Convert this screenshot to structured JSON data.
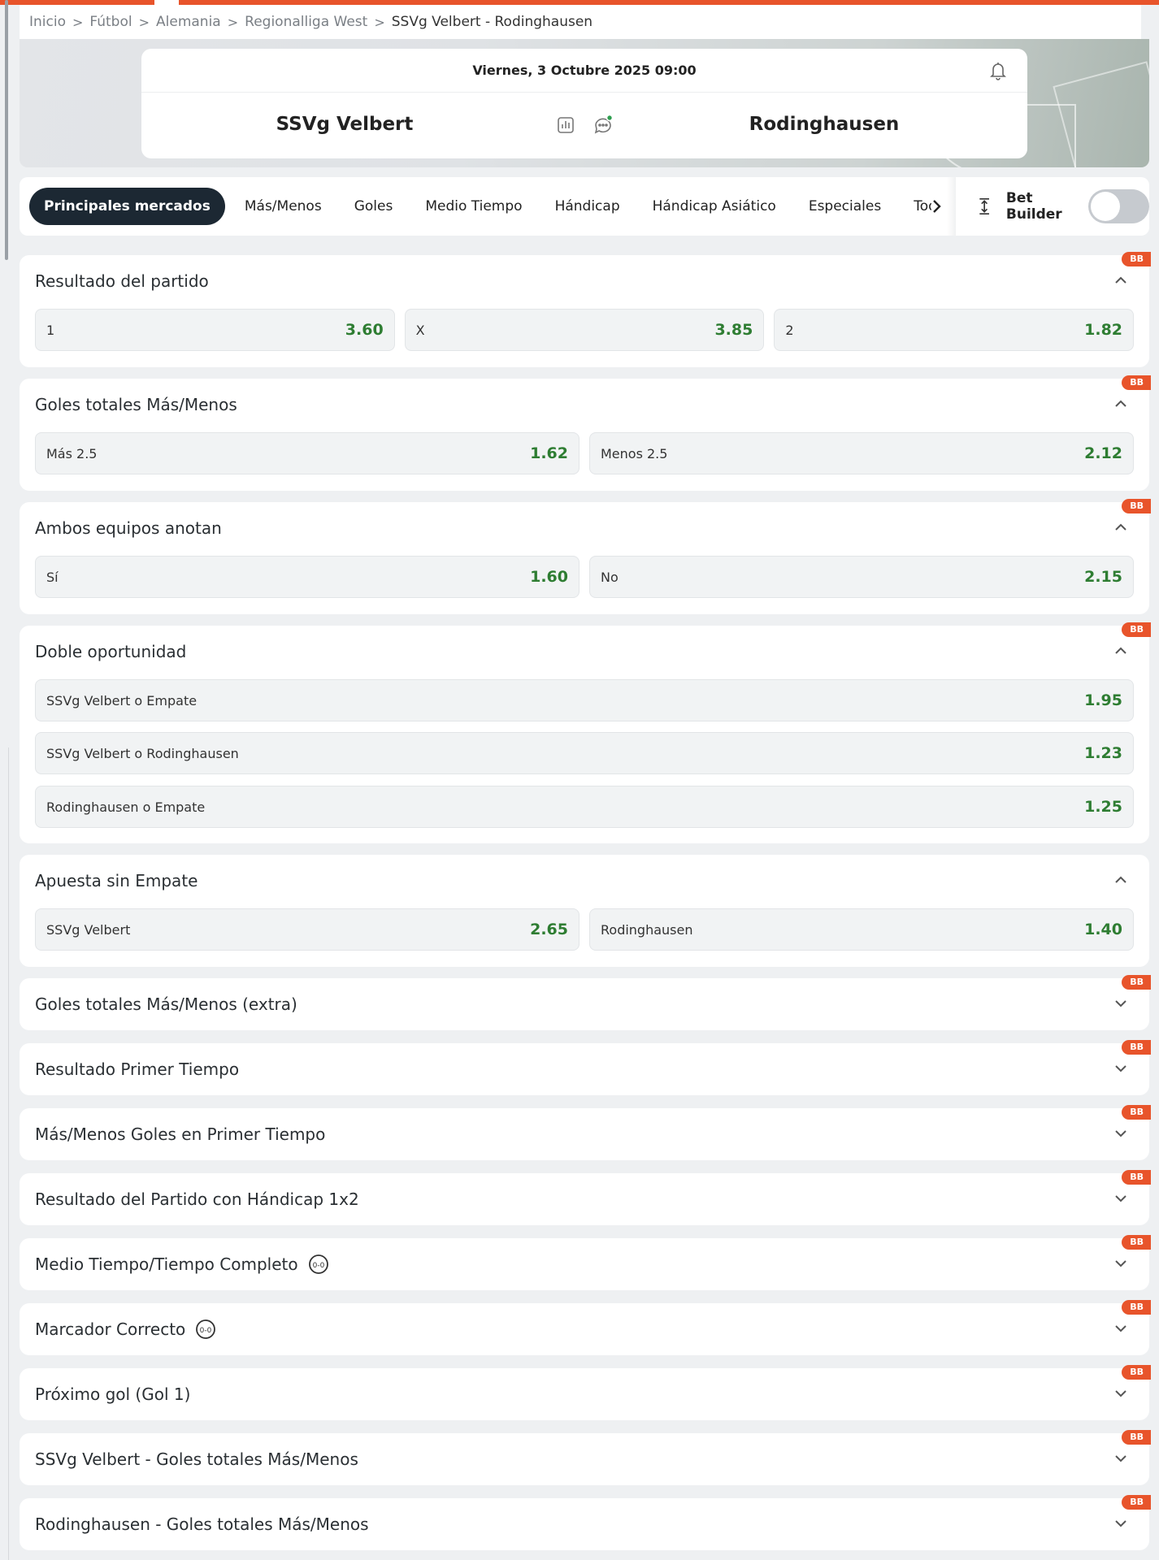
{
  "colors": {
    "accent": "#e8542b",
    "odds_green": "#2e7d32",
    "active_tab": "#1c2833"
  },
  "breadcrumb": {
    "items": [
      "Inicio",
      "Fútbol",
      "Alemania",
      "Regionalliga West"
    ],
    "current": "SSVg Velbert - Rodinghausen",
    "separator": ">"
  },
  "match": {
    "datetime": "Viernes, 3 Octubre 2025 09:00",
    "home": "SSVg Velbert",
    "away": "Rodinghausen"
  },
  "tabs": [
    "Principales mercados",
    "Más/Menos",
    "Goles",
    "Medio Tiempo",
    "Hándicap",
    "Hándicap Asiático",
    "Especiales",
    "Todos"
  ],
  "bet_builder": {
    "label": "Bet Builder",
    "enabled": false
  },
  "badge": "BB",
  "markets": {
    "m1": {
      "title": "Resultado del partido",
      "odds": [
        {
          "label": "1",
          "value": "3.60"
        },
        {
          "label": "X",
          "value": "3.85"
        },
        {
          "label": "2",
          "value": "1.82"
        }
      ]
    },
    "m2": {
      "title": "Goles totales Más/Menos",
      "odds": [
        {
          "label": "Más 2.5",
          "value": "1.62"
        },
        {
          "label": "Menos 2.5",
          "value": "2.12"
        }
      ]
    },
    "m3": {
      "title": "Ambos equipos anotan",
      "odds": [
        {
          "label": "Sí",
          "value": "1.60"
        },
        {
          "label": "No",
          "value": "2.15"
        }
      ]
    },
    "m4": {
      "title": "Doble oportunidad",
      "odds": [
        {
          "label": "SSVg Velbert o Empate",
          "value": "1.95"
        },
        {
          "label": "SSVg Velbert o Rodinghausen",
          "value": "1.23"
        },
        {
          "label": "Rodinghausen o Empate",
          "value": "1.25"
        }
      ]
    },
    "m5": {
      "title": "Apuesta sin Empate",
      "odds": [
        {
          "label": "SSVg Velbert",
          "value": "2.65"
        },
        {
          "label": "Rodinghausen",
          "value": "1.40"
        }
      ]
    },
    "c1": {
      "title": "Goles totales Más/Menos (extra)"
    },
    "c2": {
      "title": "Resultado Primer Tiempo"
    },
    "c3": {
      "title": "Más/Menos Goles en Primer Tiempo"
    },
    "c4": {
      "title": "Resultado del Partido con Hándicap 1x2"
    },
    "c5": {
      "title": "Medio Tiempo/Tiempo Completo"
    },
    "c6": {
      "title": "Marcador Correcto"
    },
    "c7": {
      "title": "Próximo gol (Gol 1)"
    },
    "c8": {
      "title": "SSVg Velbert - Goles totales Más/Menos"
    },
    "c9": {
      "title": "Rodinghausen - Goles totales Más/Menos"
    }
  }
}
